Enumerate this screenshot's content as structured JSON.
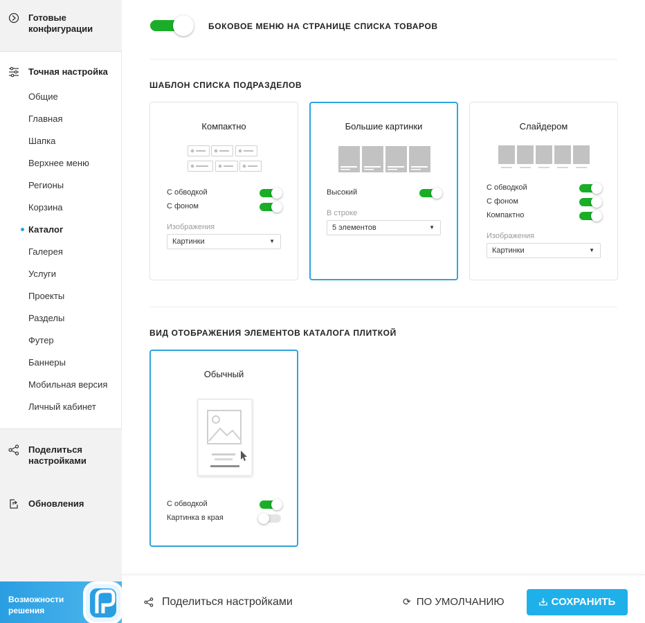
{
  "sidebar": {
    "presets_label": "Готовые конфигурации",
    "fine_tune_label": "Точная настройка",
    "items": [
      {
        "label": "Общие"
      },
      {
        "label": "Главная"
      },
      {
        "label": "Шапка"
      },
      {
        "label": "Верхнее меню"
      },
      {
        "label": "Регионы"
      },
      {
        "label": "Корзина"
      },
      {
        "label": "Каталог",
        "active": true
      },
      {
        "label": "Галерея"
      },
      {
        "label": "Услуги"
      },
      {
        "label": "Проекты"
      },
      {
        "label": "Разделы"
      },
      {
        "label": "Футер"
      },
      {
        "label": "Баннеры"
      },
      {
        "label": "Мобильная версия"
      },
      {
        "label": "Личный кабинет"
      }
    ],
    "share_label": "Поделиться настройками",
    "updates_label": "Обновления",
    "promo_label": "Возможности решения"
  },
  "main": {
    "side_menu": {
      "label": "Боковое меню на странице списка товаров",
      "enabled": true
    },
    "subsections": {
      "title": "Шаблон списка подразделов",
      "cards": [
        {
          "title": "Компактно",
          "selected": false,
          "options": [
            {
              "label": "С обводкой",
              "on": true
            },
            {
              "label": "С фоном",
              "on": true
            }
          ],
          "select_label": "Изображения",
          "select_value": "Картинки"
        },
        {
          "title": "Большие картинки",
          "selected": true,
          "options": [
            {
              "label": "Высокий",
              "on": true
            }
          ],
          "select_label": "В строке",
          "select_value": "5 элементов"
        },
        {
          "title": "Слайдером",
          "selected": false,
          "options": [
            {
              "label": "С обводкой",
              "on": true
            },
            {
              "label": "С фоном",
              "on": true
            },
            {
              "label": "Компактно",
              "on": true
            }
          ],
          "select_label": "Изображения",
          "select_value": "Картинки"
        }
      ]
    },
    "tiles": {
      "title": "Вид отображения элементов каталога плиткой",
      "cards": [
        {
          "title": "Обычный",
          "selected": true,
          "options": [
            {
              "label": "С обводкой",
              "on": true
            },
            {
              "label": "Картинка в края",
              "on": false
            }
          ]
        }
      ]
    }
  },
  "footer": {
    "share_label": "Поделиться настройками",
    "reset_label": "ПО УМОЛЧАНИЮ",
    "save_label": "СОХРАНИТЬ"
  },
  "colors": {
    "accent": "#1fb0ea",
    "toggle_on": "#1aae28",
    "selected_border": "#2ea4db"
  }
}
